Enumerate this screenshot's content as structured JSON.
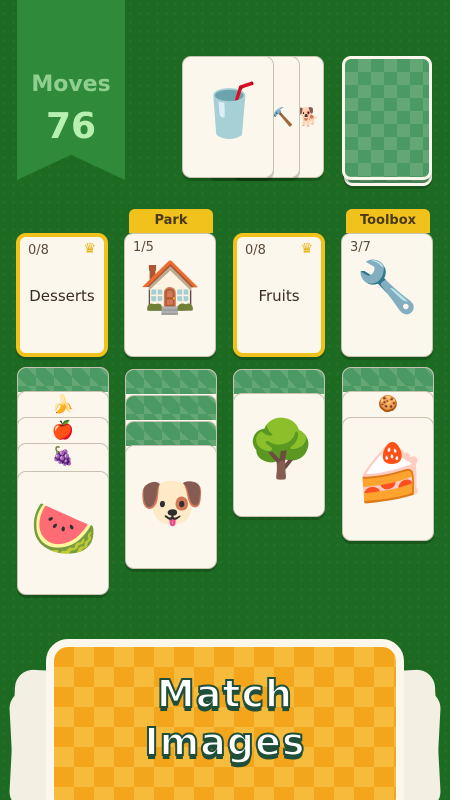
{
  "moves": {
    "label": "Moves",
    "value": "76"
  },
  "colors": {
    "table_green": "#1d6b23",
    "banner_green": "#2f8a3a",
    "category_yellow": "#f1c21b",
    "card_back_green": "#4c9a63",
    "promo_orange": "#f3a51c"
  },
  "top_row": {
    "waste_pile": {
      "top_card_icon": "milkshake",
      "peek_icons": [
        "hammer",
        "dog"
      ]
    },
    "draw_pile": {
      "icon": "card-back"
    }
  },
  "category_row": [
    {
      "tab": "",
      "count": "0/8",
      "name": "Desserts",
      "icon": "crown"
    },
    {
      "tab": "Park",
      "count": "1/5",
      "name": "",
      "icon": "birdhouse"
    },
    {
      "tab": "",
      "count": "0/8",
      "name": "Fruits",
      "icon": "crown"
    },
    {
      "tab": "Toolbox",
      "count": "3/7",
      "name": "",
      "icon": "wrench"
    }
  ],
  "columns": [
    {
      "stack_icons": [
        "banana",
        "apple",
        "grapes"
      ],
      "top_icon": "watermelon"
    },
    {
      "stack_icons": [],
      "top_icon": "puppy"
    },
    {
      "stack_icons": [],
      "top_icon": "tree"
    },
    {
      "stack_icons": [
        "cookie"
      ],
      "top_icon": "chocolate-cake"
    }
  ],
  "promo": {
    "line1": "Match",
    "line2": "Images"
  }
}
